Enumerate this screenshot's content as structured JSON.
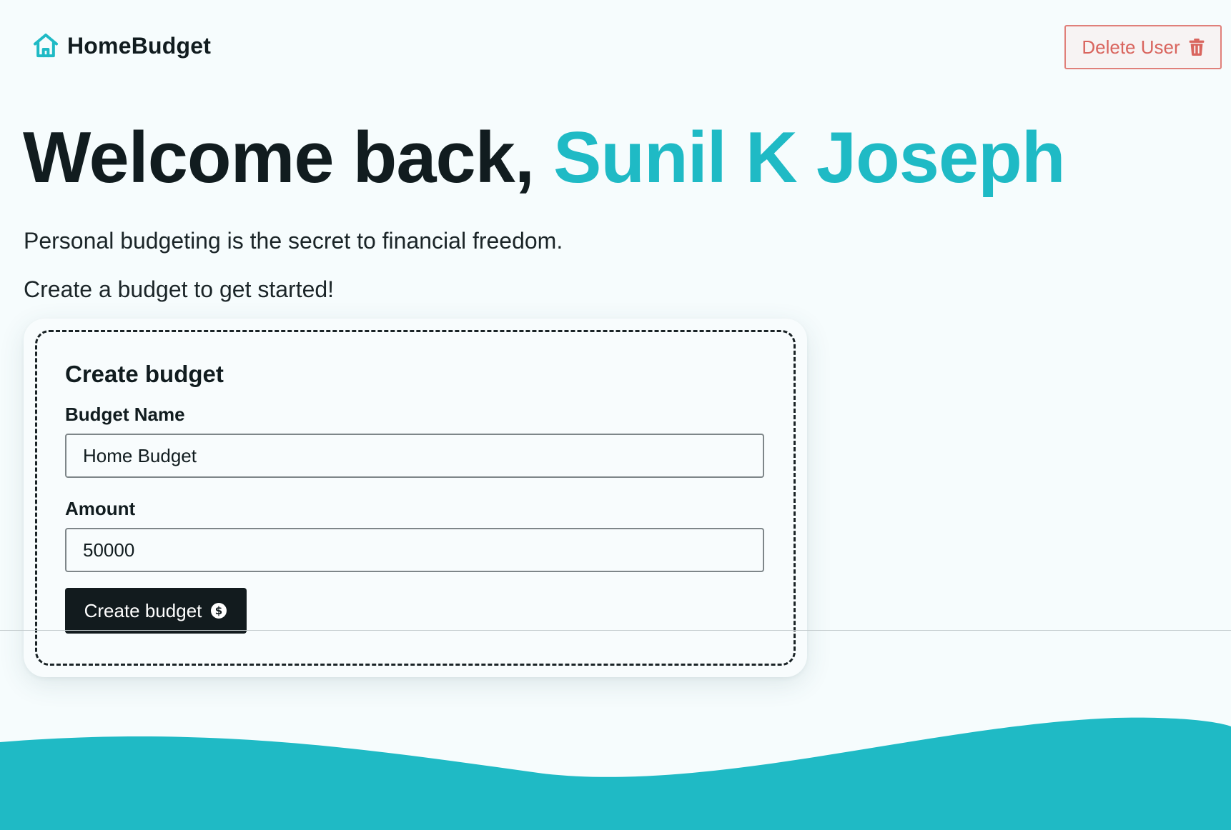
{
  "nav": {
    "brand": "HomeBudget",
    "brand_icon": "house-icon",
    "delete_button": {
      "label": "Delete User",
      "icon": "trash-icon"
    }
  },
  "welcome": {
    "prefix": "Welcome back,",
    "user_name": "Sunil K Joseph",
    "tagline": "Personal budgeting is the secret to financial freedom.",
    "cta_text": "Create a budget to get started!"
  },
  "form": {
    "title": "Create budget",
    "budget_name": {
      "label": "Budget Name",
      "value": "Home Budget"
    },
    "amount": {
      "label": "Amount",
      "value": "50000"
    },
    "submit": {
      "label": "Create budget",
      "icon": "dollar-circle-icon"
    }
  },
  "theme": {
    "accent": "#1fbac5",
    "danger": "#d9655e",
    "text": "#111c1f",
    "background": "#f6fcfd",
    "button_dark": "#121b1e"
  }
}
